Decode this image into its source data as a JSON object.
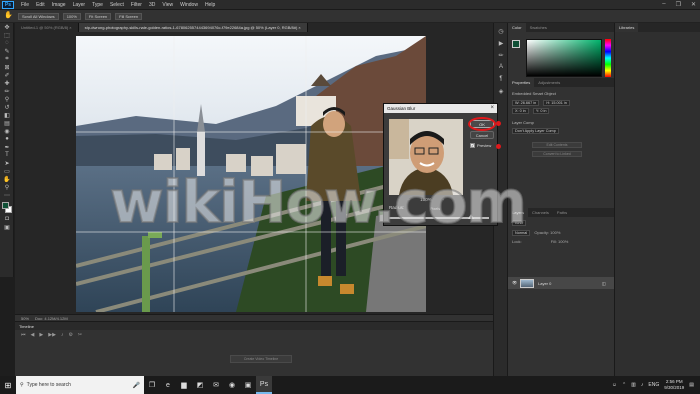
{
  "menu": {
    "logo": "Ps",
    "items": [
      "File",
      "Edit",
      "Image",
      "Layer",
      "Type",
      "Select",
      "Filter",
      "3D",
      "View",
      "Window",
      "Help"
    ],
    "window_controls": [
      "–",
      "❐",
      "✕"
    ]
  },
  "options": {
    "buttons": [
      "Scroll All Windows",
      "100%",
      "Fit Screen",
      "Fill Screen"
    ]
  },
  "tabs": [
    {
      "label": "Untitled-1 @ 50% (RGB/8) ×",
      "active": false
    },
    {
      "label": "stp-dwrong-photography-skills-nale-golden-ratios-1-6780625574443694076c-f79e22684a.jpg @ 50% (Layer 0, RGB/8#) ×",
      "active": true
    }
  ],
  "status": {
    "zoom": "50%",
    "doc": "Doc: 4.12M/4.12M"
  },
  "timeline": {
    "title": "Timeline",
    "create_button": "Create Video Timeline"
  },
  "colors": {
    "foreground": "#0f4f35",
    "accent": "#31a8ff",
    "annotation": "#e0181b"
  },
  "color_panel": {
    "tabs": [
      "Color",
      "Swatches"
    ]
  },
  "libraries": {
    "title": "Libraries"
  },
  "properties": {
    "tabs": [
      "Properties",
      "Adjustments"
    ],
    "type": "Embedded Smart Object",
    "w": "W: 26.667 in",
    "h": "H: 15.001 in",
    "x": "X: 0 in",
    "y": "Y: 0 in",
    "layer_comp": "Layer Comp",
    "no_comp": "Don't Apply Layer Comp",
    "edit_contents": "Edit Contents",
    "convert": "Convert to Linked"
  },
  "layers": {
    "tabs": [
      "Layers",
      "Channels",
      "Paths"
    ],
    "kind": "Kind",
    "mode": "Normal",
    "opacity": "Opacity: 100%",
    "lock": "Lock:",
    "fill": "Fill: 100%",
    "items": [
      {
        "name": "Layer 0"
      }
    ]
  },
  "dialog": {
    "title": "Gaussian Blur",
    "ok": "OK",
    "cancel": "Cancel",
    "preview_label": "Preview",
    "preview_checked": true,
    "zoom": "100%",
    "zoom_out": "−",
    "zoom_in": "+",
    "radius_label": "Radius:",
    "radius_unit": "Pixels",
    "radius_fraction": 0.82
  },
  "watermark": "wikiHow.com",
  "taskbar": {
    "search_placeholder": "Type here to search",
    "time": "2:56 PM",
    "date": "9/30/2019",
    "lang": "ENG"
  }
}
